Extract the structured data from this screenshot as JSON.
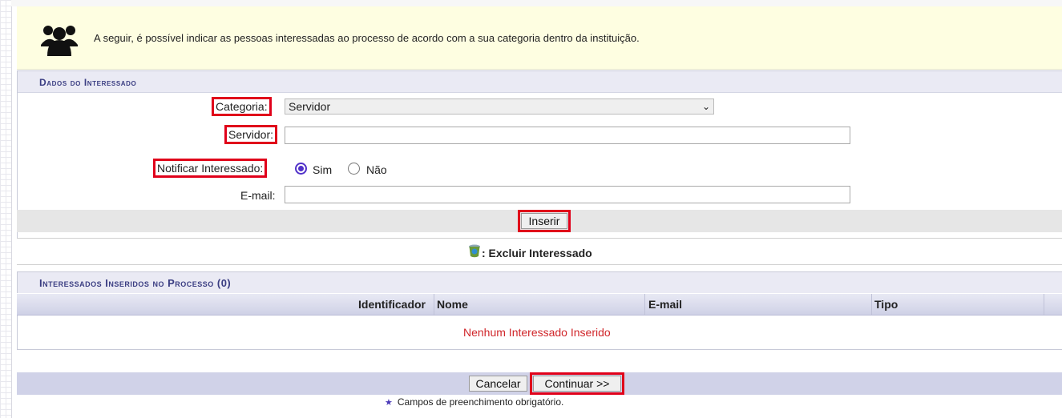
{
  "banner": {
    "icon": "users-group-icon",
    "text": "A seguir, é possível indicar as pessoas interessadas ao processo de acordo com a sua categoria dentro da instituição."
  },
  "form": {
    "caption": "Dados do Interessado",
    "categoria_label": "Categoria:",
    "categoria_value": "Servidor",
    "servidor_label": "Servidor:",
    "servidor_value": "",
    "notificar_label": "Notificar Interessado:",
    "notificar_options": [
      "Sim",
      "Não"
    ],
    "notificar_selected": "Sim",
    "email_label": "E-mail:",
    "email_value": "",
    "inserir_button": "Inserir"
  },
  "legend": {
    "icon": "trash-icon",
    "text": ": Excluir Interessado"
  },
  "table": {
    "caption": "Interessados Inseridos no Processo (0)",
    "columns": [
      "Identificador",
      "Nome",
      "E-mail",
      "Tipo"
    ],
    "empty_message": "Nenhum Interessado Inserido"
  },
  "footer": {
    "cancel_button": "Cancelar",
    "continue_button": "Continuar >>",
    "required_note": "Campos de preenchimento obrigatório."
  },
  "colors": {
    "caption_text": "#3a3d82",
    "highlight": "#e0001a",
    "empty_text": "#d0262a",
    "banner_bg": "#fefee1"
  }
}
